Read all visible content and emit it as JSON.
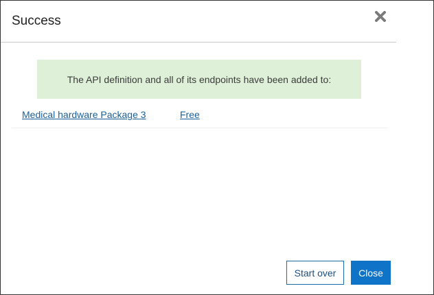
{
  "dialog": {
    "title": "Success",
    "close_icon": "close-x-icon"
  },
  "banner": {
    "message": "The API definition and all of its endpoints have been added to:",
    "background_color": "#dff0d8"
  },
  "package": {
    "name": "Medical hardware Package 3",
    "plan": "Free"
  },
  "footer": {
    "start_over_label": "Start over",
    "close_label": "Close",
    "primary_color": "#0f73c8"
  }
}
